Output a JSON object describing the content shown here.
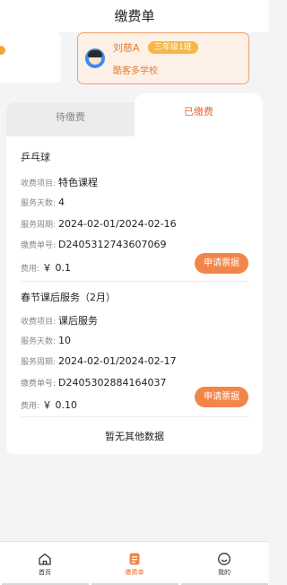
{
  "header": {
    "title": "缴费单"
  },
  "student": {
    "name": "刘慈A",
    "grade_class": "三年级1班",
    "school": "酷客多学校"
  },
  "tabs": [
    {
      "label": "待缴费",
      "active": false
    },
    {
      "label": "已缴费",
      "active": true
    }
  ],
  "labels": {
    "item": "收费项目:",
    "days": "服务天数:",
    "period": "服务周期:",
    "order_no": "缴费单号:",
    "fee": "费用:"
  },
  "records": [
    {
      "title": "乒乓球",
      "item": "特色课程",
      "days": "4",
      "period": "2024-02-01/2024-02-16",
      "order_no": "D2405312743607069",
      "fee": "￥ 0.1",
      "button": "申请票据"
    },
    {
      "title": "春节课后服务（2月）",
      "item": "课后服务",
      "days": "10",
      "period": "2024-02-01/2024-02-17",
      "order_no": "D2405302884164037",
      "fee": "￥ 0.10",
      "button": "申请票据"
    }
  ],
  "empty_text": "暂无其他数据",
  "nav": [
    {
      "label": "首页",
      "icon": "home-icon",
      "active": false
    },
    {
      "label": "缴费单",
      "icon": "bill-icon",
      "active": true
    },
    {
      "label": "我的",
      "icon": "smile-icon",
      "active": false
    }
  ],
  "colors": {
    "accent": "#ea6a2a",
    "button": "#f2864a",
    "badge": "#f6b74a",
    "card_bg": "#fdf0e6"
  }
}
